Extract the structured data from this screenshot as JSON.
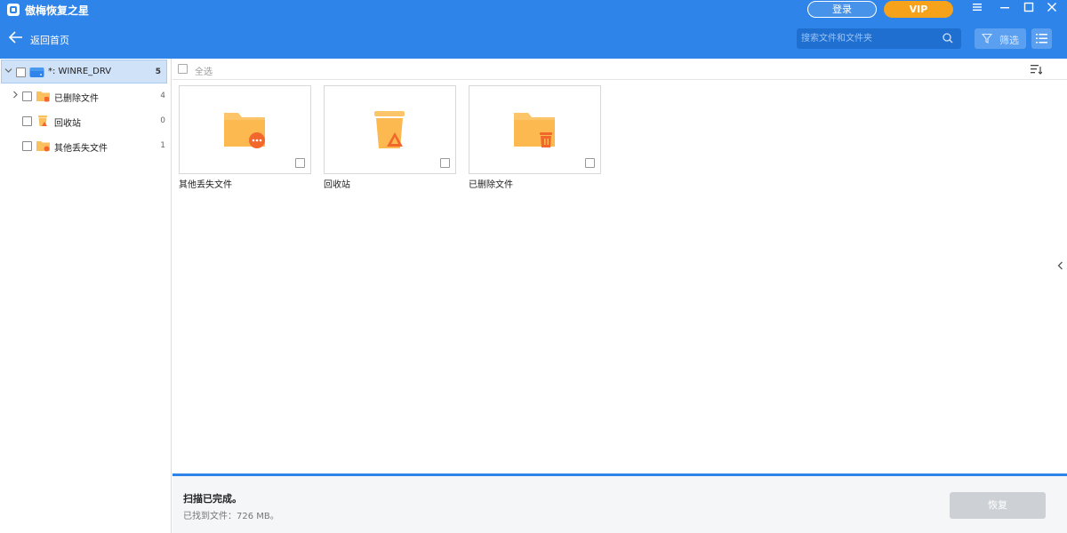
{
  "app": {
    "title": "傲梅恢复之星",
    "login_label": "登录",
    "vip_label": "VIP"
  },
  "nav": {
    "back_label": "返回首页"
  },
  "search": {
    "placeholder": "搜索文件和文件夹"
  },
  "toolbar": {
    "filter_label": "筛选",
    "select_all_label": "全选"
  },
  "sidebar": {
    "items": [
      {
        "label": "*: WINRE_DRV",
        "count": "5",
        "icon": "drive-icon"
      },
      {
        "label": "已删除文件",
        "count": "4",
        "icon": "deleted-folder-icon"
      },
      {
        "label": "回收站",
        "count": "0",
        "icon": "recycle-bin-icon"
      },
      {
        "label": "其他丢失文件",
        "count": "1",
        "icon": "lost-folder-icon"
      }
    ]
  },
  "files": [
    {
      "label": "其他丢失文件",
      "icon": "lost-folder-icon"
    },
    {
      "label": "回收站",
      "icon": "recycle-bin-icon"
    },
    {
      "label": "已删除文件",
      "icon": "deleted-folder-icon"
    }
  ],
  "status": {
    "scan_complete": "扫描已完成。",
    "found_text": "已找到文件：726 MB。",
    "recover_label": "恢复"
  },
  "colors": {
    "accent": "#2e84e8",
    "vip": "#f7a21b",
    "folder": "#fbbf5e",
    "badge": "#f2682c"
  }
}
